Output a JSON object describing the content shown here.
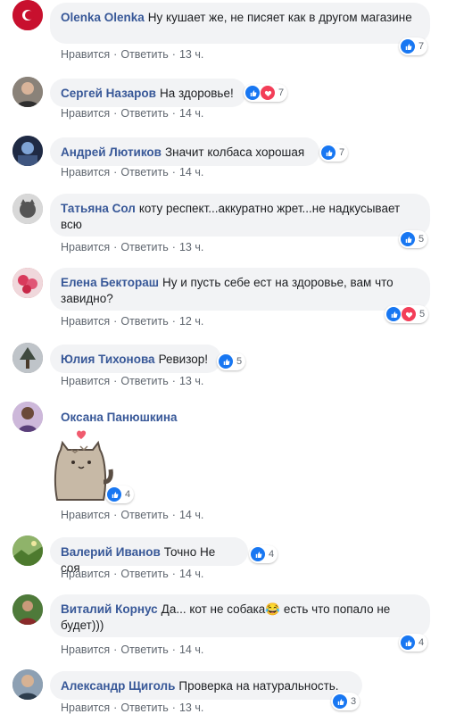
{
  "actions": {
    "like_label": "Нравится",
    "reply_label": "Ответить",
    "separator": "·"
  },
  "comments": [
    {
      "author": "Olenka Olenka",
      "text": "Ну кушает же, не писяет как в другом магазине",
      "time": "13 ч.",
      "reactions": [
        "like"
      ],
      "count": "7"
    },
    {
      "author": "Сергей Назаров",
      "text": "На здоровье!",
      "time": "14 ч.",
      "reactions": [
        "like",
        "love"
      ],
      "count": "7"
    },
    {
      "author": "Андрей Лютиков",
      "text": "Значит колбаса хорошая",
      "time": "14 ч.",
      "reactions": [
        "like"
      ],
      "count": "7"
    },
    {
      "author": "Татьяна Сол",
      "text": "коту респект...аккуратно жрет...не надкусывает всю",
      "time": "13 ч.",
      "reactions": [
        "like"
      ],
      "count": "5"
    },
    {
      "author": "Елена Бектораш",
      "text": "Ну и пусть себе ест на здоровье, вам что завидно?",
      "time": "12 ч.",
      "reactions": [
        "like",
        "love"
      ],
      "count": "5"
    },
    {
      "author": "Юлия Тихонова",
      "text": "Ревизор!",
      "time": "13 ч.",
      "reactions": [
        "like"
      ],
      "count": "5"
    },
    {
      "author": "Оксана Панюшкина",
      "text": "",
      "time": "14 ч.",
      "reactions": [
        "like"
      ],
      "count": "4",
      "sticker": "pusheen-cat-heart-sticker"
    },
    {
      "author": "Валерий Иванов",
      "text": "Точно Не соя",
      "time": "14 ч.",
      "reactions": [
        "like"
      ],
      "count": "4"
    },
    {
      "author": "Виталий Корнус",
      "text": "Да... кот не собака",
      "text2": "есть что попало не будет)))",
      "emoji": "😂",
      "time": "14 ч.",
      "reactions": [
        "like"
      ],
      "count": "4"
    },
    {
      "author": "Александр Щиголь",
      "text": "Проверка на натуральность.",
      "time": "13 ч.",
      "reactions": [
        "like"
      ],
      "count": "3"
    }
  ],
  "colors": {
    "author": "#385898",
    "bubble": "#f2f3f5",
    "like": "#1877f2",
    "love": "#f33e58",
    "meta": "#606770"
  }
}
